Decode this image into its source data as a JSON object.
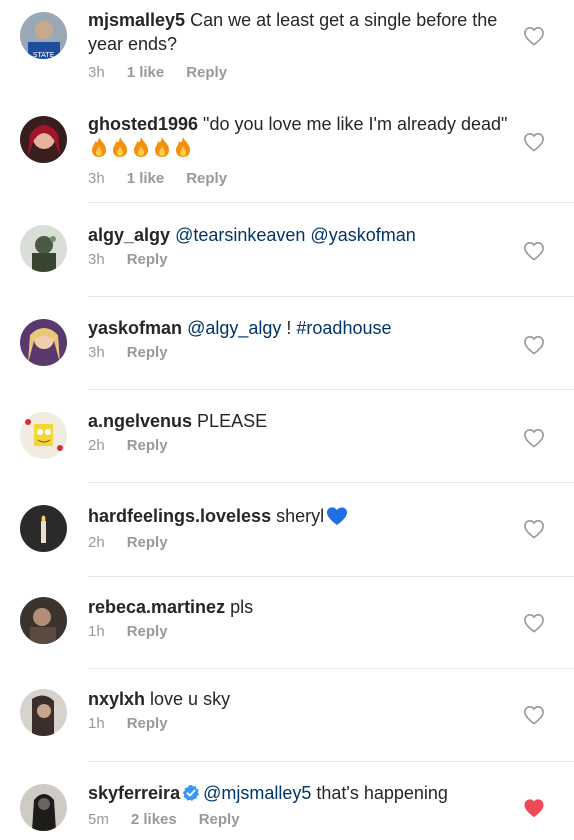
{
  "comments": [
    {
      "username": "mjsmalley5",
      "text": " Can we at least get a single before the year ends?",
      "time": "3h",
      "likes": "1 like",
      "reply": "Reply"
    },
    {
      "username": "ghosted1996",
      "text": " \"do you love me like I'm already dead\"",
      "time": "3h",
      "likes": "1 like",
      "reply": "Reply",
      "emoji": "fire x5"
    },
    {
      "username": "algy_algy",
      "text": "",
      "mentions": [
        "@tearsinkeaven",
        "@yaskofman"
      ],
      "time": "3h",
      "reply": "Reply"
    },
    {
      "username": "yaskofman",
      "mention1": "@algy_algy",
      "mid": " ! ",
      "hashtag": "#roadhouse",
      "time": "3h",
      "reply": "Reply"
    },
    {
      "username": "a.ngelvenus",
      "text": " PLEASE",
      "time": "2h",
      "reply": "Reply"
    },
    {
      "username": "hardfeelings.loveless",
      "text": " sheryl",
      "time": "2h",
      "reply": "Reply",
      "emoji": "blue heart"
    },
    {
      "username": "rebeca.martinez",
      "text": " pls",
      "time": "1h",
      "reply": "Reply"
    },
    {
      "username": "nxylxh",
      "text": " love u sky",
      "time": "1h",
      "reply": "Reply"
    },
    {
      "username": "skyferreira",
      "mention": "@mjsmalley5",
      "text": " that's happening",
      "time": "5m",
      "likes": "2 likes",
      "reply": "Reply",
      "verified": true,
      "liked": true
    }
  ],
  "colors": {
    "heart_outline": "#999999",
    "heart_liked": "#ed4956",
    "mention": "#003569",
    "meta": "#999999",
    "verified": "#3897f0"
  }
}
